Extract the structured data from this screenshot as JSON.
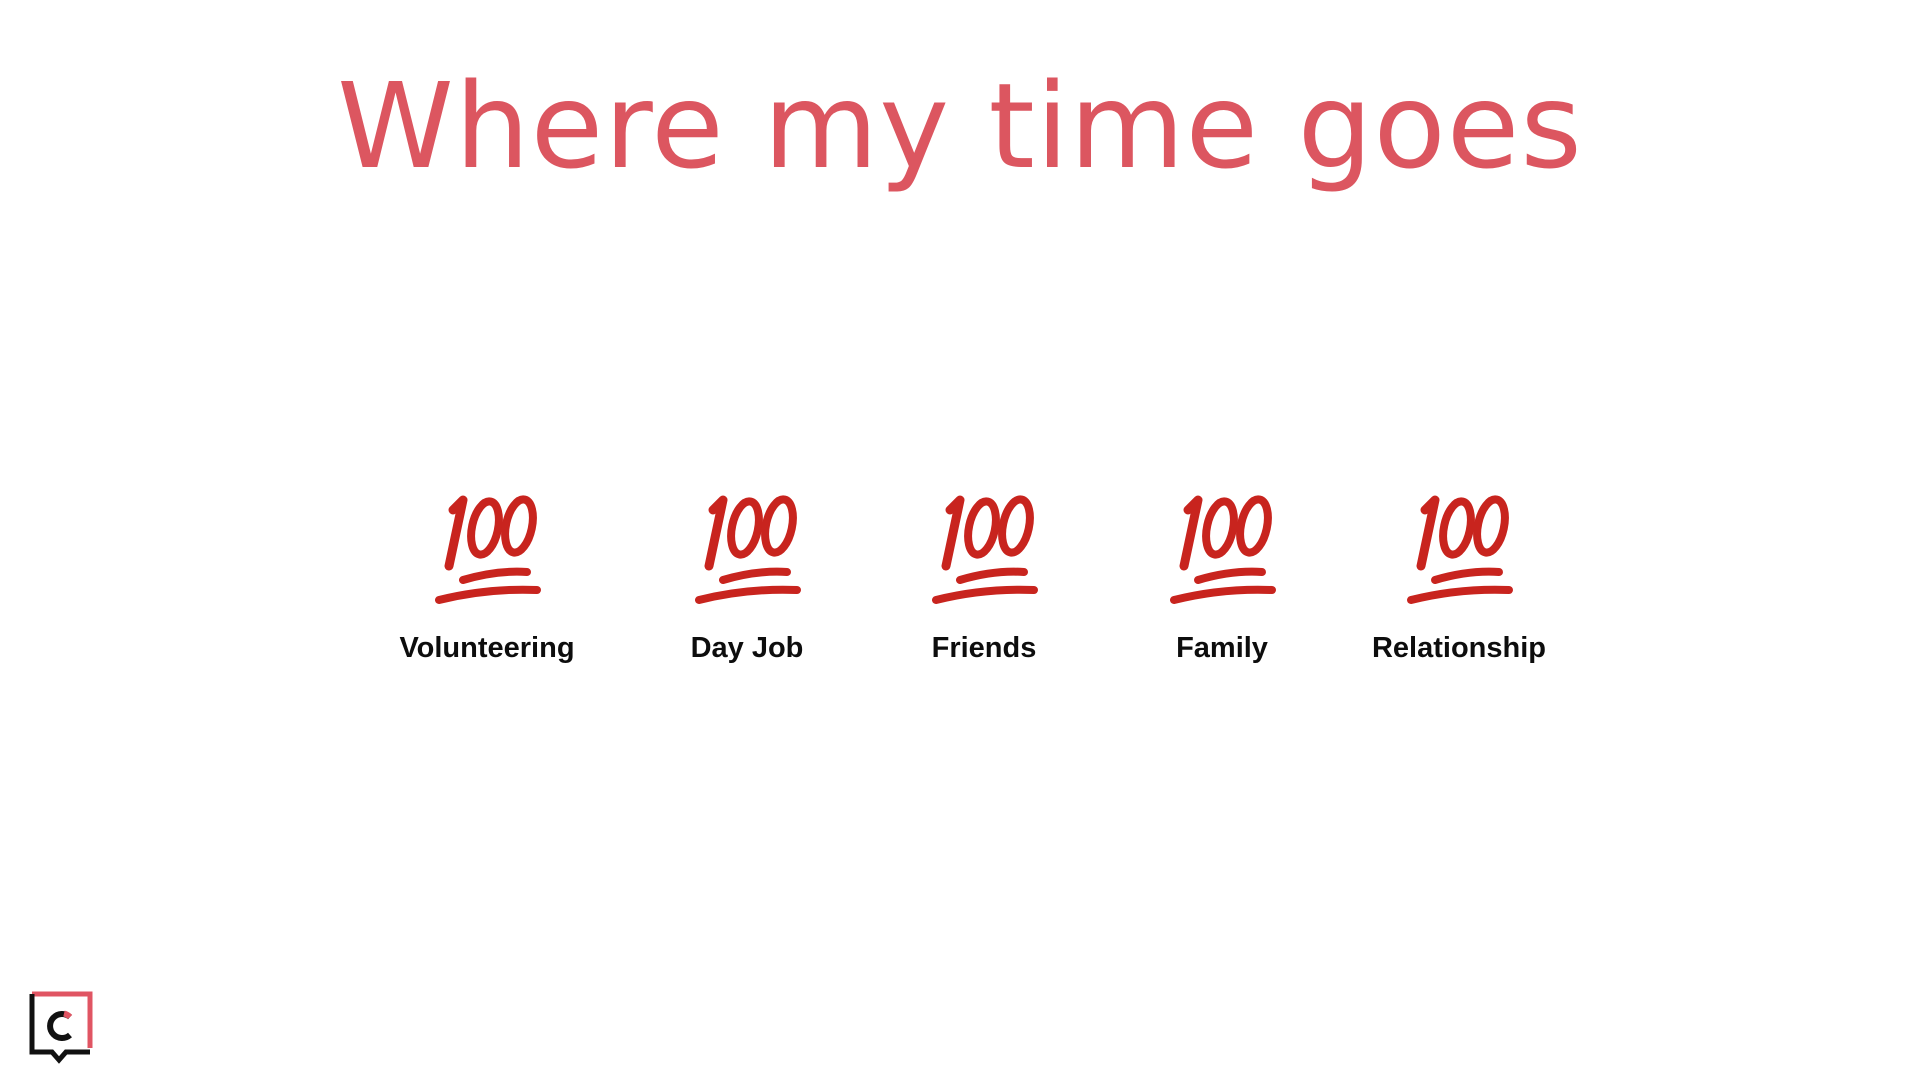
{
  "slide": {
    "title": "Where my time goes",
    "accent_color": "#dc5660",
    "emoji_color": "#c8241e",
    "categories": [
      {
        "label": "Volunteering",
        "icon": "hundred-points-icon"
      },
      {
        "label": "Day Job",
        "icon": "hundred-points-icon"
      },
      {
        "label": "Friends",
        "icon": "hundred-points-icon"
      },
      {
        "label": "Family",
        "icon": "hundred-points-icon"
      },
      {
        "label": "Relationship",
        "icon": "hundred-points-icon"
      }
    ]
  },
  "logo": {
    "icon": "brand-logo-c-icon"
  }
}
